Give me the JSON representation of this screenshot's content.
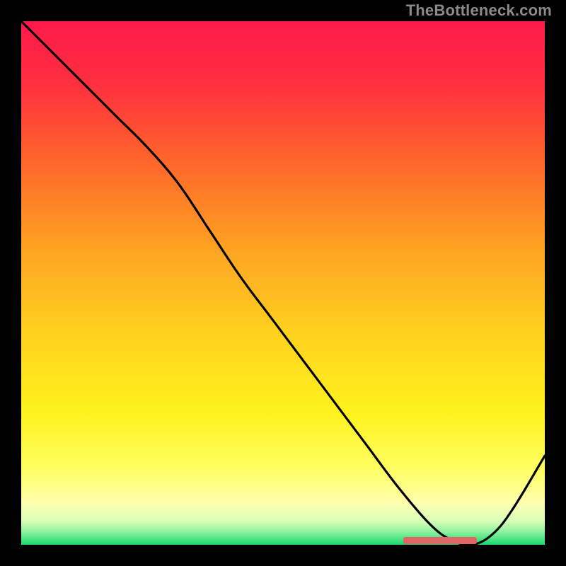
{
  "watermark": "TheBottleneck.com",
  "colors": {
    "background": "#000000",
    "line": "#000000",
    "bar": "#e06666",
    "gradient_stops": [
      {
        "offset": 0.0,
        "color": "#ff1a4b"
      },
      {
        "offset": 0.12,
        "color": "#ff2f3f"
      },
      {
        "offset": 0.28,
        "color": "#ff6a2a"
      },
      {
        "offset": 0.45,
        "color": "#ffa822"
      },
      {
        "offset": 0.6,
        "color": "#ffd21e"
      },
      {
        "offset": 0.75,
        "color": "#fff31e"
      },
      {
        "offset": 0.86,
        "color": "#ffff66"
      },
      {
        "offset": 0.92,
        "color": "#ffffb0"
      },
      {
        "offset": 0.955,
        "color": "#d8ffb8"
      },
      {
        "offset": 0.975,
        "color": "#8ef2a0"
      },
      {
        "offset": 1.0,
        "color": "#17d96d"
      }
    ]
  },
  "chart_data": {
    "type": "line",
    "title": "",
    "xlabel": "",
    "ylabel": "",
    "xlim": [
      0,
      100
    ],
    "ylim": [
      0,
      100
    ],
    "grid": false,
    "legend": false,
    "series": [
      {
        "name": "bottleneck-curve",
        "x": [
          0,
          6,
          12,
          18,
          24,
          30,
          36,
          42,
          48,
          54,
          60,
          66,
          72,
          78,
          82,
          86,
          90,
          94,
          100
        ],
        "y": [
          100,
          94,
          88,
          82,
          76,
          69,
          60,
          51,
          43,
          35,
          27,
          19,
          11,
          4,
          1,
          0,
          2,
          7,
          17
        ]
      }
    ],
    "marker_bar": {
      "x0": 73,
      "x1": 87,
      "y": 0.8
    }
  }
}
